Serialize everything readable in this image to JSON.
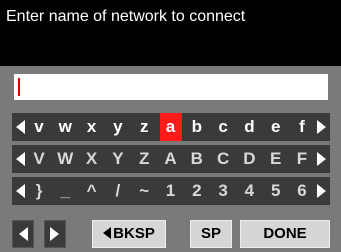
{
  "title": "Enter name of network to connect",
  "input": {
    "value": ""
  },
  "rows": {
    "lower": [
      "v",
      "w",
      "x",
      "y",
      "z",
      "a",
      "b",
      "c",
      "d",
      "e",
      "f"
    ],
    "upper": [
      "V",
      "W",
      "X",
      "Y",
      "Z",
      "A",
      "B",
      "C",
      "D",
      "E",
      "F"
    ],
    "symbols": [
      "}",
      "_",
      "^",
      "/",
      "~",
      "1",
      "2",
      "3",
      "4",
      "5",
      "6"
    ]
  },
  "selected_key": "a",
  "buttons": {
    "bksp": "BKSP",
    "sp": "SP",
    "done": "DONE"
  },
  "colors": {
    "highlight": "#ff1a1a",
    "background": "#000000",
    "panel": "#7a7a7a"
  }
}
